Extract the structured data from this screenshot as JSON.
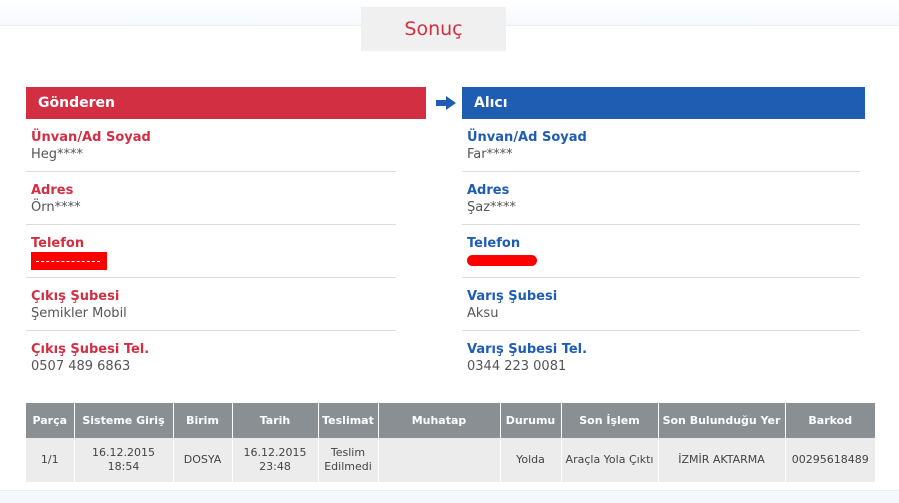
{
  "result": {
    "title": "Sonuç"
  },
  "sender": {
    "header": "Gönderen",
    "fields": [
      {
        "label": "Ünvan/Ad Soyad",
        "value": "Heg****"
      },
      {
        "label": "Adres",
        "value": "Örn****"
      },
      {
        "label": "Telefon",
        "value": ""
      },
      {
        "label": "Çıkış Şubesi",
        "value": "Şemikler Mobil"
      },
      {
        "label": "Çıkış Şubesi Tel.",
        "value": "0507 489 6863"
      }
    ]
  },
  "receiver": {
    "header": "Alıcı",
    "fields": [
      {
        "label": "Ünvan/Ad Soyad",
        "value": "Far****"
      },
      {
        "label": "Adres",
        "value": "Şaz****"
      },
      {
        "label": "Telefon",
        "value": ""
      },
      {
        "label": "Varış Şubesi",
        "value": "Aksu"
      },
      {
        "label": "Varış Şubesi Tel.",
        "value": "0344 223 0081"
      }
    ]
  },
  "icons": {
    "arrow": "arrow-right-icon"
  },
  "colors": {
    "sender": "#d22f43",
    "receiver": "#1f5db2",
    "table_header": "#8a8f93",
    "redaction": "#ff0000"
  },
  "table": {
    "columns": [
      "Parça",
      "Sisteme Giriş",
      "Birim",
      "Tarih",
      "Teslimat",
      "Muhatap",
      "Durumu",
      "Son İşlem",
      "Son Bulunduğu Yer",
      "Barkod"
    ],
    "row": {
      "parca": "1/1",
      "sisteme_giris_date": "16.12.2015",
      "sisteme_giris_time": "18:54",
      "birim": "DOSYA",
      "tarih_date": "16.12.2015",
      "tarih_time": "23:48",
      "teslimat_line1": "Teslim",
      "teslimat_line2": "Edilmedi",
      "muhatap": "",
      "durumu": "Yolda",
      "son_islem": "Araçla Yola Çıktı",
      "son_yer": "İZMİR AKTARMA",
      "barkod": "00295618489"
    }
  }
}
